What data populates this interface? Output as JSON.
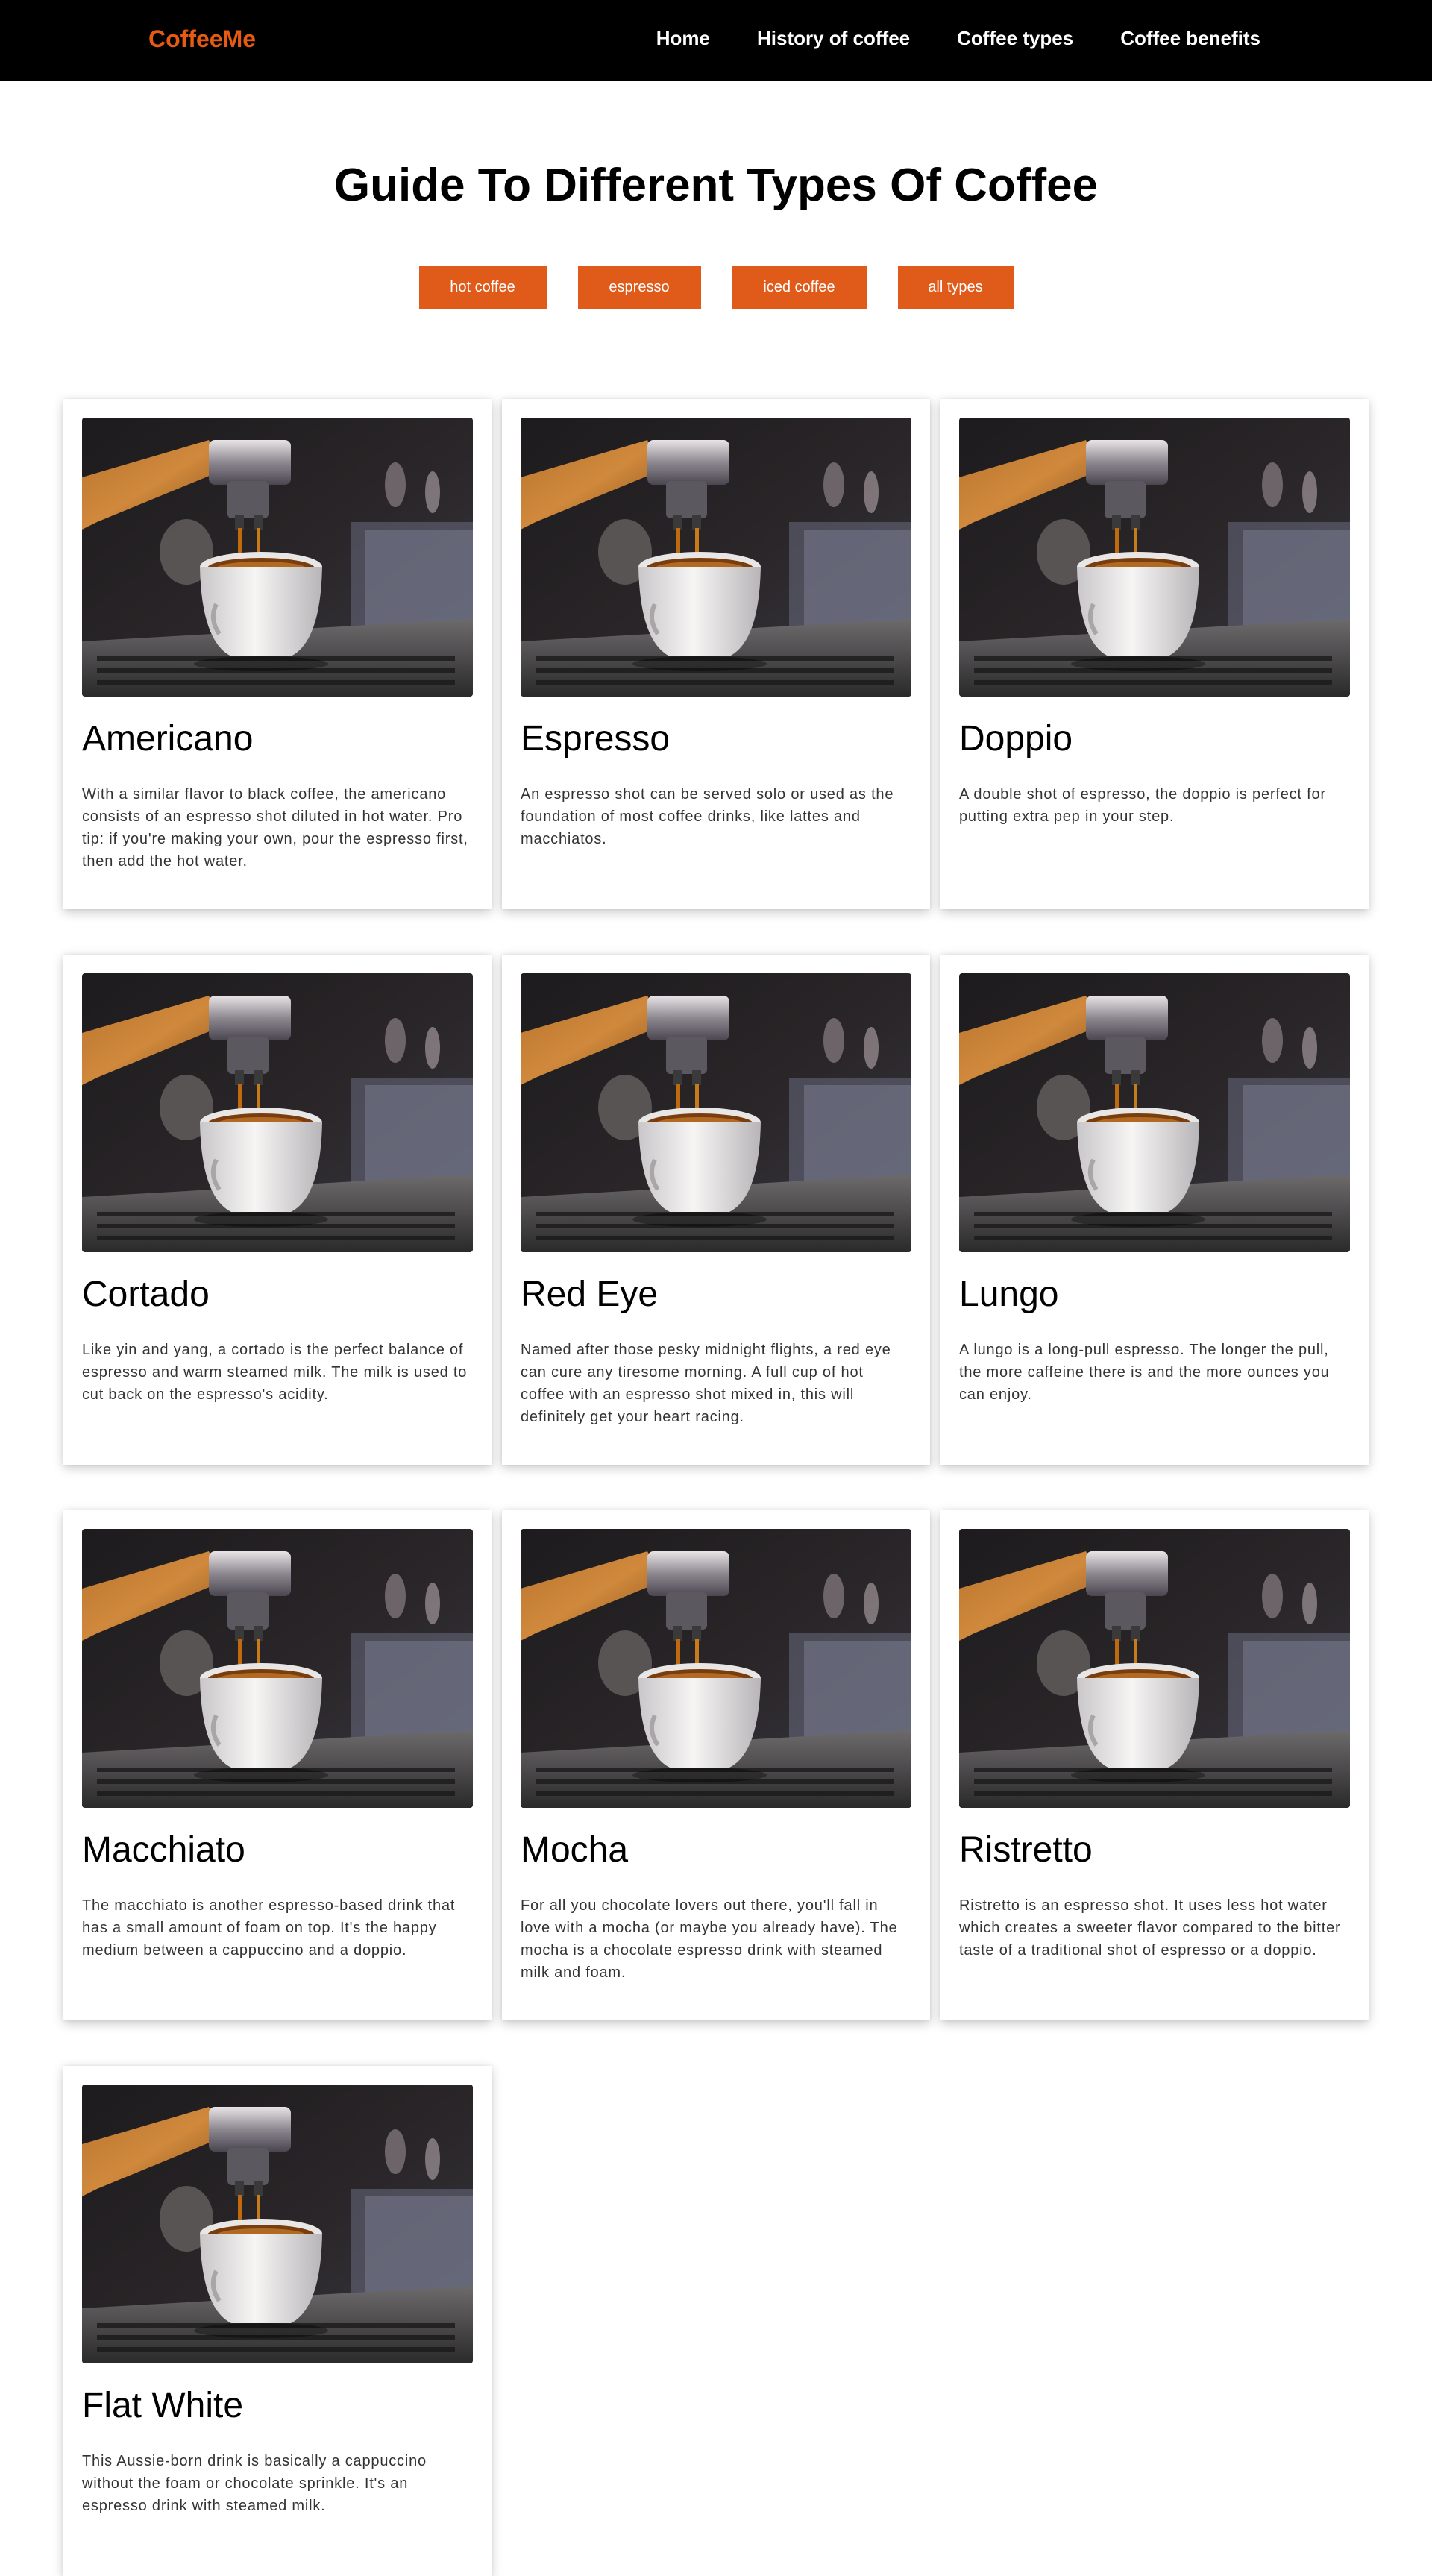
{
  "header": {
    "logo": "CoffeeMe",
    "nav": [
      {
        "label": "Home"
      },
      {
        "label": "History of coffee"
      },
      {
        "label": "Coffee types"
      },
      {
        "label": "Coffee benefits"
      }
    ]
  },
  "main": {
    "title": "Guide To Different Types Of Coffee",
    "filters": [
      {
        "label": "hot coffee"
      },
      {
        "label": "espresso"
      },
      {
        "label": "iced coffee"
      },
      {
        "label": "all types"
      }
    ],
    "cards": [
      {
        "title": "Americano",
        "desc": "With a similar flavor to black coffee, the americano consists of an espresso shot diluted in hot water. Pro tip: if you're making your own, pour the espresso first, then add the hot water."
      },
      {
        "title": "Espresso",
        "desc": "An espresso shot can be served solo or used as the foundation of most coffee drinks, like lattes and macchiatos."
      },
      {
        "title": "Doppio",
        "desc": "A double shot of espresso, the doppio is perfect for putting extra pep in your step."
      },
      {
        "title": "Cortado",
        "desc": "Like yin and yang, a cortado is the perfect balance of espresso and warm steamed milk. The milk is used to cut back on the espresso's acidity."
      },
      {
        "title": "Red Eye",
        "desc": "Named after those pesky midnight flights, a red eye can cure any tiresome morning. A full cup of hot coffee with an espresso shot mixed in, this will definitely get your heart racing."
      },
      {
        "title": "Lungo",
        "desc": "A lungo is a long-pull espresso. The longer the pull, the more caffeine there is and the more ounces you can enjoy."
      },
      {
        "title": "Macchiato",
        "desc": "The macchiato is another espresso-based drink that has a small amount of foam on top. It's the happy medium between a cappuccino and a doppio."
      },
      {
        "title": "Mocha",
        "desc": "For all you chocolate lovers out there, you'll fall in love with a mocha (or maybe you already have). The mocha is a chocolate espresso drink with steamed milk and foam."
      },
      {
        "title": "Ristretto",
        "desc": "Ristretto is an espresso shot. It uses less hot water which creates a sweeter flavor compared to the bitter taste of a traditional shot of espresso or a doppio."
      },
      {
        "title": "Flat White",
        "desc": "This Aussie-born drink is basically a cappuccino without the foam or chocolate sprinkle. It's an espresso drink with steamed milk."
      }
    ]
  },
  "colors": {
    "accent": "#e05a1a",
    "logo": "#e55b13",
    "navbar": "#000000"
  }
}
